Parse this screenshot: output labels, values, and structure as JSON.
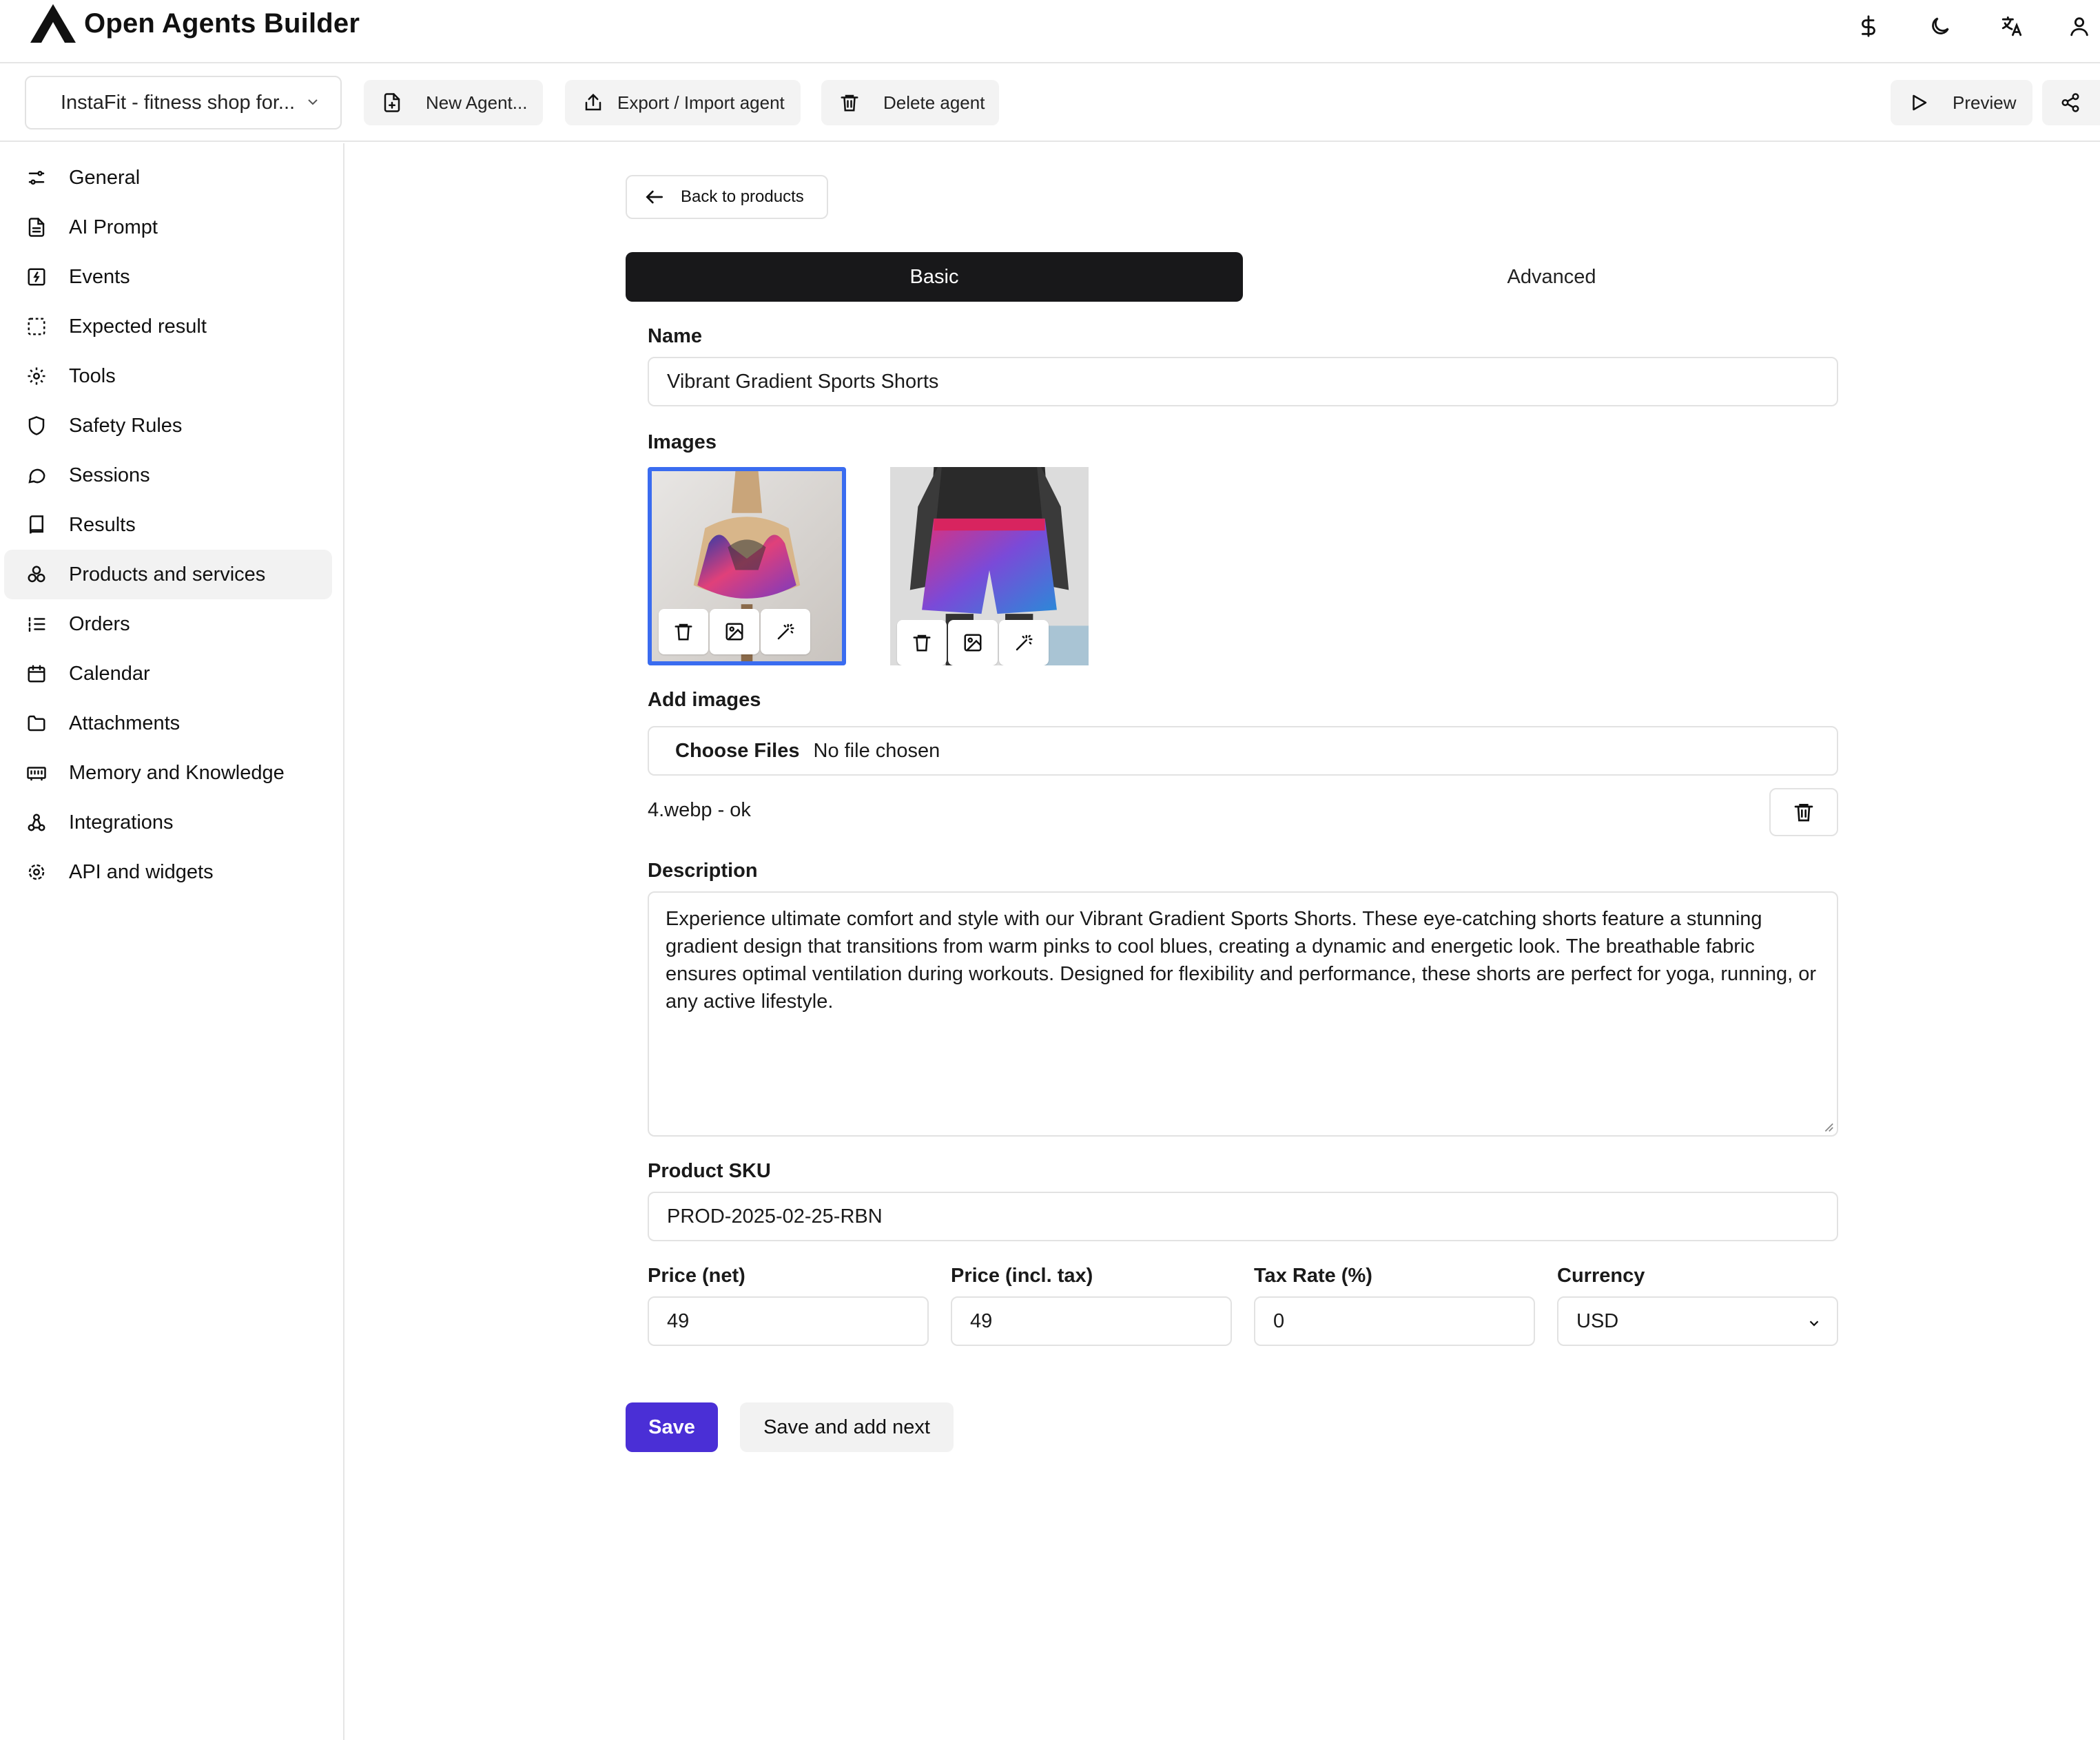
{
  "header": {
    "app_title": "Open Agents Builder",
    "icons": [
      "dollar-icon",
      "moon-icon",
      "translate-icon",
      "user-icon"
    ]
  },
  "toolbar": {
    "agent_selected": "InstaFit - fitness shop for...",
    "new_agent": "New Agent...",
    "export_import": "Export / Import agent",
    "delete_agent": "Delete agent",
    "preview": "Preview"
  },
  "sidebar": {
    "items": [
      {
        "label": "General",
        "icon": "sliders-icon"
      },
      {
        "label": "AI Prompt",
        "icon": "file-text-icon"
      },
      {
        "label": "Events",
        "icon": "bolt-square-icon"
      },
      {
        "label": "Expected result",
        "icon": "dashed-square-icon"
      },
      {
        "label": "Tools",
        "icon": "gear-icon"
      },
      {
        "label": "Safety Rules",
        "icon": "shield-icon"
      },
      {
        "label": "Sessions",
        "icon": "chat-icon"
      },
      {
        "label": "Results",
        "icon": "book-icon"
      },
      {
        "label": "Products and services",
        "icon": "boxes-icon",
        "active": true
      },
      {
        "label": "Orders",
        "icon": "list-ordered-icon"
      },
      {
        "label": "Calendar",
        "icon": "calendar-icon"
      },
      {
        "label": "Attachments",
        "icon": "folder-icon"
      },
      {
        "label": "Memory and Knowledge",
        "icon": "memory-icon"
      },
      {
        "label": "Integrations",
        "icon": "webhook-icon"
      },
      {
        "label": "API and widgets",
        "icon": "cog-icon"
      }
    ]
  },
  "main": {
    "back_label": "Back to products",
    "tabs": [
      {
        "label": "Basic",
        "active": true
      },
      {
        "label": "Advanced",
        "active": false
      }
    ],
    "name_label": "Name",
    "name_value": "Vibrant Gradient Sports Shorts",
    "images_label": "Images",
    "images": [
      {
        "subject": "sports bra on mannequin",
        "selected": true
      },
      {
        "subject": "gradient shorts on mannequin",
        "selected": false
      }
    ],
    "add_images_label": "Add images",
    "choose_files": "Choose Files",
    "no_file": "No file chosen",
    "uploaded_file": "4.webp - ok",
    "description_label": "Description",
    "description_value": "Experience ultimate comfort and style with our Vibrant Gradient Sports Shorts. These eye-catching shorts feature a stunning gradient design that transitions from warm pinks to cool blues, creating a dynamic and energetic look. The breathable fabric ensures optimal ventilation during workouts. Designed for flexibility and performance, these shorts are perfect for yoga, running, or any active lifestyle.",
    "sku_label": "Product SKU",
    "sku_value": "PROD-2025-02-25-RBN",
    "price_net_label": "Price (net)",
    "price_net_value": "49",
    "price_gross_label": "Price (incl. tax)",
    "price_gross_value": "49",
    "tax_label": "Tax Rate (%)",
    "tax_value": "0",
    "currency_label": "Currency",
    "currency_value": "USD",
    "save": "Save",
    "save_next": "Save and add next"
  },
  "colors": {
    "accent": "#4a2fd6",
    "tab_active_bg": "#18181a",
    "image_selected_border": "#3a6cf0",
    "border": "#e2e2e2"
  }
}
